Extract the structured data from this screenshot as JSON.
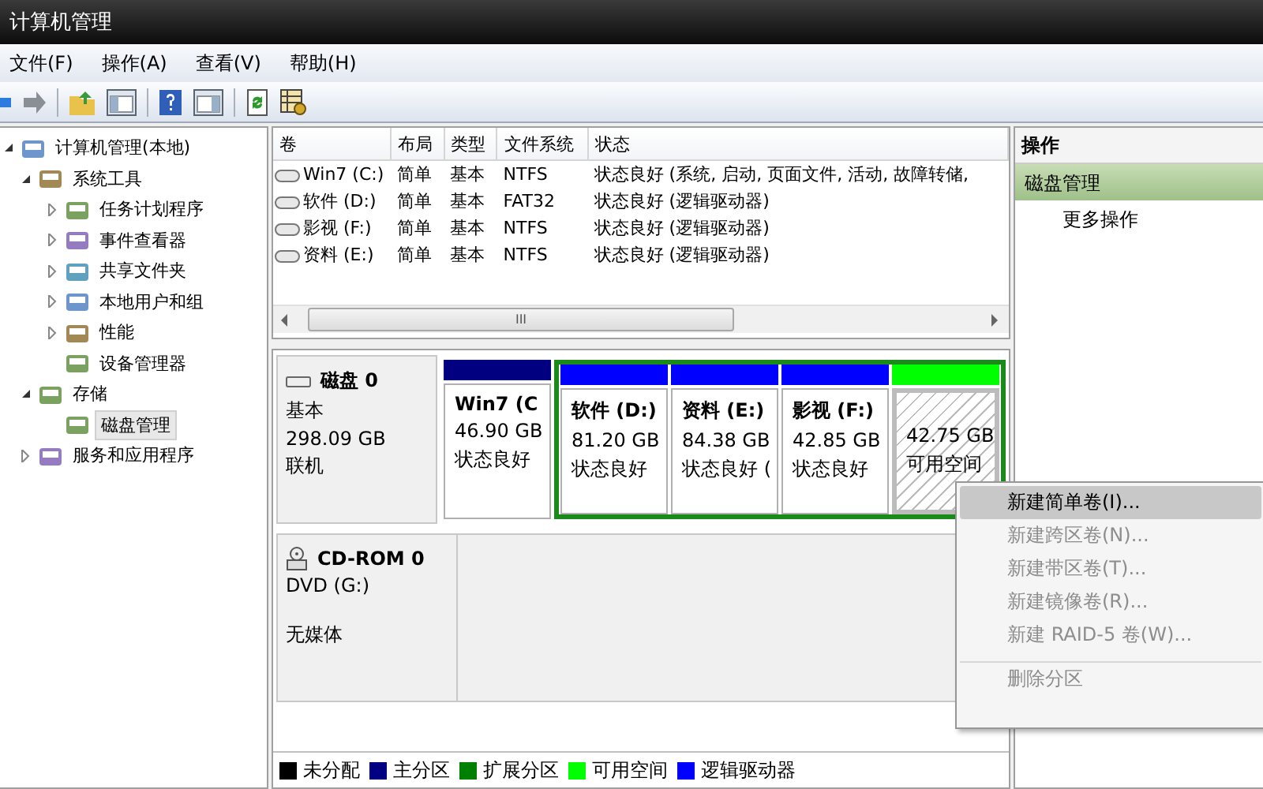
{
  "window": {
    "title": "计算机管理"
  },
  "menu": [
    "文件(F)",
    "操作(A)",
    "查看(V)",
    "帮助(H)"
  ],
  "tree": [
    {
      "label": "计算机管理(本地)",
      "selected": false,
      "expanded": true,
      "children": [
        {
          "label": "系统工具",
          "selected": false,
          "expanded": true,
          "children": [
            {
              "label": "任务计划程序",
              "selected": false,
              "expanded": false
            },
            {
              "label": "事件查看器",
              "selected": false,
              "expanded": false
            },
            {
              "label": "共享文件夹",
              "selected": false,
              "expanded": false
            },
            {
              "label": "本地用户和组",
              "selected": false,
              "expanded": false
            },
            {
              "label": "性能",
              "selected": false,
              "expanded": false
            },
            {
              "label": "设备管理器",
              "selected": false
            }
          ]
        },
        {
          "label": "存储",
          "selected": false,
          "expanded": true,
          "children": [
            {
              "label": "磁盘管理",
              "selected": true
            }
          ]
        },
        {
          "label": "服务和应用程序",
          "selected": false,
          "expanded": false
        }
      ]
    }
  ],
  "volumes": {
    "columns": [
      "卷",
      "布局",
      "类型",
      "文件系统",
      "状态"
    ],
    "rows": [
      [
        "Win7 (C:)",
        "简单",
        "基本",
        "NTFS",
        "状态良好 (系统, 启动, 页面文件, 活动, 故障转储,"
      ],
      [
        "软件 (D:)",
        "简单",
        "基本",
        "FAT32",
        "状态良好 (逻辑驱动器)"
      ],
      [
        "影视 (F:)",
        "简单",
        "基本",
        "NTFS",
        "状态良好 (逻辑驱动器)"
      ],
      [
        "资料 (E:)",
        "简单",
        "基本",
        "NTFS",
        "状态良好 (逻辑驱动器)"
      ]
    ],
    "scroll_label": "III"
  },
  "disks": [
    {
      "kind": "basic",
      "name": "磁盘 0",
      "lines": [
        "基本",
        "298.09 GB",
        "联机"
      ],
      "partitions": [
        {
          "kind": "primary",
          "color": "#000080",
          "name": "Win7  (C",
          "size": "46.90 GB",
          "status": "状态良好"
        },
        {
          "kind": "extended",
          "children": [
            {
              "kind": "primary",
              "color": "#0000ff",
              "name": "软件  (D:)",
              "size": "81.20 GB",
              "status": "状态良好"
            },
            {
              "kind": "primary",
              "color": "#0000ff",
              "name": "资料  (E:)",
              "size": "84.38 GB",
              "status": "状态良好 ("
            },
            {
              "kind": "primary",
              "color": "#0000ff",
              "name": "影视  (F:)",
              "size": "42.85 GB",
              "status": "状态良好"
            },
            {
              "kind": "free",
              "color": "#00ff00",
              "size": "42.75 GB",
              "status": "可用空间"
            }
          ]
        }
      ]
    },
    {
      "kind": "cdrom",
      "name": "CD-ROM 0",
      "lines": [
        "DVD (G:)",
        "无媒体"
      ]
    }
  ],
  "legend": [
    {
      "label": "未分配",
      "color": "#000000"
    },
    {
      "label": "主分区",
      "color": "#000080"
    },
    {
      "label": "扩展分区",
      "color": "#008000"
    },
    {
      "label": "可用空间",
      "color": "#00ff00"
    },
    {
      "label": "逻辑驱动器",
      "color": "#0000ff"
    }
  ],
  "actions": {
    "title": "操作",
    "items": [
      {
        "kind": "section",
        "label": "磁盘管理"
      },
      {
        "kind": "link",
        "label": "更多操作"
      }
    ]
  },
  "context_menu": [
    {
      "label": "新建简单卷(I)...",
      "selected": true,
      "disabled": false,
      "separator_before": false
    },
    {
      "label": "新建跨区卷(N)...",
      "selected": false,
      "disabled": true,
      "separator_before": false
    },
    {
      "label": "新建带区卷(T)...",
      "selected": false,
      "disabled": true,
      "separator_before": false
    },
    {
      "label": "新建镜像卷(R)...",
      "selected": false,
      "disabled": true,
      "separator_before": false
    },
    {
      "label": "新建 RAID-5 卷(W)...",
      "selected": false,
      "disabled": true,
      "separator_before": false
    },
    {
      "label": "删除分区",
      "selected": false,
      "disabled": true,
      "separator_before": true
    }
  ]
}
